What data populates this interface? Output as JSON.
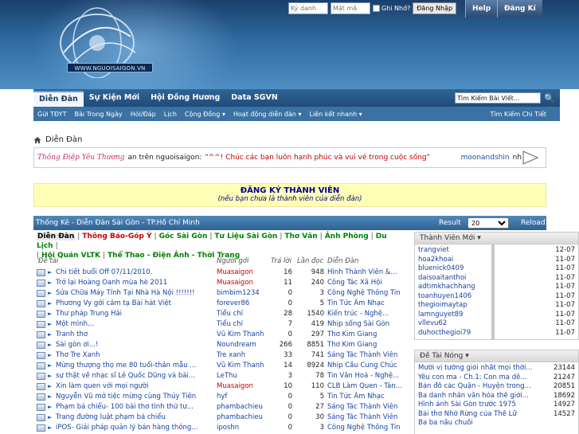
{
  "header": {
    "logo_text": "WWW.NGUOISAIGON.VN",
    "username_placeholder": "Ký danh",
    "password_placeholder": "Mật mã",
    "remember_label": "Ghi Nhớ?",
    "login_button": "Đăng Nhập",
    "help_button": "Help",
    "register_button": "Đăng Kí"
  },
  "navbar": {
    "tabs": [
      {
        "label": "Diễn Đàn"
      },
      {
        "label": "Sự Kiện Mới"
      },
      {
        "label": "Hội Đồng Hương"
      },
      {
        "label": "Data SGVN"
      }
    ],
    "search_placeholder": "Tìm Kiếm Bài Viết..."
  },
  "subnav": {
    "items": [
      "Gửi TĐYT",
      "Bài Trong Ngày",
      "Hỏi/Đáp",
      "Lịch",
      "Cộng Đồng ▾",
      "Hoạt động diễn đàn ▾",
      "Liên kết nhanh ▾"
    ],
    "advanced_search": "Tìm Kiếm Chi Tiết"
  },
  "breadcrumb": {
    "label": "Diễn Đàn"
  },
  "announcement": {
    "logo_text": "Thông Điệp Yêu Thương",
    "prefix": "an trên nguoisaigon:",
    "message": "\"^^! Chúc các bạn luôn hạnh phúc và vui vẻ trong cuộc sống\"",
    "author": "moonandshin",
    "author_suffix": "nh"
  },
  "register_banner": {
    "title": "ĐĂNG KÝ THÀNH VIÊN",
    "subtitle": "(nếu bạn chưa là thành viên của diễn đàn)"
  },
  "stats": {
    "title": "Thống Kê - Diễn Đàn Sài Gòn - TP.Hồ Chí Minh",
    "result_label": "Result",
    "result_value": "20",
    "reload_label": "Reload"
  },
  "forum_filter": {
    "lines": [
      [
        "Diễn Đàn",
        "Thông Báo-Góp Ý",
        "Góc Sài Gòn",
        "Tư Liệu Sài Gòn",
        "Thơ Văn",
        "Ảnh Phòng",
        "Du Lịch"
      ],
      [
        "Hội Quán VLTK",
        "Thể Thao - Điện Ảnh - Thời Trang"
      ]
    ]
  },
  "thread_columns": {
    "title": "Đề tài",
    "poster": "Người gởi",
    "replies": "Trả lời",
    "views": "Lần đọc",
    "forum": "Diễn Đàn"
  },
  "threads": [
    {
      "title": "Chi tiết buổi Off 07/11/2010.",
      "user": "Muasaigon",
      "red": true,
      "replies": "16",
      "views": "948",
      "forum": "Hình Thành Viên &..."
    },
    {
      "title": "Trở lại Hoàng Oanh mùa hè 2011",
      "user": "Muasaigon",
      "red": true,
      "replies": "11",
      "views": "240",
      "forum": "Công Tác Xã Hội"
    },
    {
      "title": "Sửa Chữa Máy Tính Tại Nhà Hà Nội !!!!!!!",
      "user": "bimbim1234",
      "red": false,
      "replies": "0",
      "views": "3",
      "forum": "Công Nghệ Thông Tin"
    },
    {
      "title": "Phương Vy gởi cảm tạ Bài hát Việt",
      "user": "forever86",
      "red": false,
      "replies": "0",
      "views": "5",
      "forum": "Tin Tức Âm Nhạc"
    },
    {
      "title": "Thư pháp Trung Hải",
      "user": "Tiểu chí",
      "red": false,
      "replies": "28",
      "views": "1540",
      "forum": "Kiến trúc - Nghệ..."
    },
    {
      "title": "Một mình...",
      "user": "Tiểu chí",
      "red": false,
      "replies": "7",
      "views": "419",
      "forum": "Nhịp sống Sài Gòn"
    },
    {
      "title": "Tranh thơ",
      "user": "Vũ Kim Thanh",
      "red": false,
      "replies": "0",
      "views": "297",
      "forum": "Thơ Kim Giang"
    },
    {
      "title": "Sài gòn ơi...!",
      "user": "Noundream",
      "red": false,
      "replies": "266",
      "views": "8851",
      "forum": "Thơ Kim Giang"
    },
    {
      "title": "Thơ Tre Xanh",
      "user": "Tre xanh",
      "red": false,
      "replies": "33",
      "views": "741",
      "forum": "Sáng Tác Thành Viên"
    },
    {
      "title": "Mừng thượng thọ me 80 tuổi-thân mẫu ...",
      "user": "Vũ Kim Thanh",
      "red": false,
      "replies": "14",
      "views": "8924",
      "forum": "Nhịp Cầu Cung Chúc"
    },
    {
      "title": "sự thật về nhạc sĩ Lê Quốc Dũng và bài...",
      "user": "LeThu",
      "red": false,
      "replies": "3",
      "views": "78",
      "forum": "Tin Văn Hoá - Nghệ..."
    },
    {
      "title": "Xin làm quen với mọi người",
      "user": "Muasaigon",
      "red": true,
      "replies": "10",
      "views": "110",
      "forum": "CLB Làm Quen - Tán..."
    },
    {
      "title": "Nguyễn Vũ mở tiệc mừng cùng Thủy Tiên",
      "user": "hyf",
      "red": false,
      "replies": "0",
      "views": "5",
      "forum": "Tin Tức Âm Nhạc"
    },
    {
      "title": "Phạm bá chiểu- 100 bài thơ tình thứ tư...",
      "user": "phambachieu",
      "red": false,
      "replies": "0",
      "views": "27",
      "forum": "Sáng Tác Thành Viên"
    },
    {
      "title": "Trang đường luật phạm bá chiểu",
      "user": "phambachieu",
      "red": false,
      "replies": "0",
      "views": "30",
      "forum": "Sáng Tác Thành Viên"
    },
    {
      "title": "iPOS- Giải pháp quản lý bán hàng thông...",
      "user": "iposhn",
      "red": false,
      "replies": "0",
      "views": "3",
      "forum": "Công Nghệ Thông Tin"
    }
  ],
  "new_members": {
    "heading": "Thành Viên Mới",
    "items": [
      {
        "name": "trangviet",
        "date": "12-07"
      },
      {
        "name": "hoa2khoai",
        "date": "11-07"
      },
      {
        "name": "bluenick0409",
        "date": "11-07"
      },
      {
        "name": "daisoaitanthoi",
        "date": "11-07"
      },
      {
        "name": "adtimkhachhang",
        "date": "11-07"
      },
      {
        "name": "toanhuyen1406",
        "date": "11-07"
      },
      {
        "name": "thegioimaytap",
        "date": "11-07"
      },
      {
        "name": "lamnguyet89",
        "date": "11-07"
      },
      {
        "name": "vllevu62",
        "date": "11-07"
      },
      {
        "name": "duhocthegioi79",
        "date": "11-07"
      }
    ]
  },
  "hot_topics": {
    "heading": "Đề Tài Nóng",
    "items": [
      {
        "title": "Mười vị tướng giỏi nhất mọi thời...",
        "count": "23144"
      },
      {
        "title": "Yêu con ma - Ch.1: Con ma dễ...",
        "count": "21247"
      },
      {
        "title": "Bản đồ các Quận - Huyện trong...",
        "count": "20851"
      },
      {
        "title": "Ba danh nhân văn hóa thế giới...",
        "count": "18692"
      },
      {
        "title": "Hình ảnh Sài Gòn trước 1975",
        "count": "14927"
      },
      {
        "title": "Bài thơ Nhớ Rừng của Thế Lữ",
        "count": "14527"
      },
      {
        "title": "Ba ba nấu chuối",
        "count": ""
      }
    ]
  }
}
